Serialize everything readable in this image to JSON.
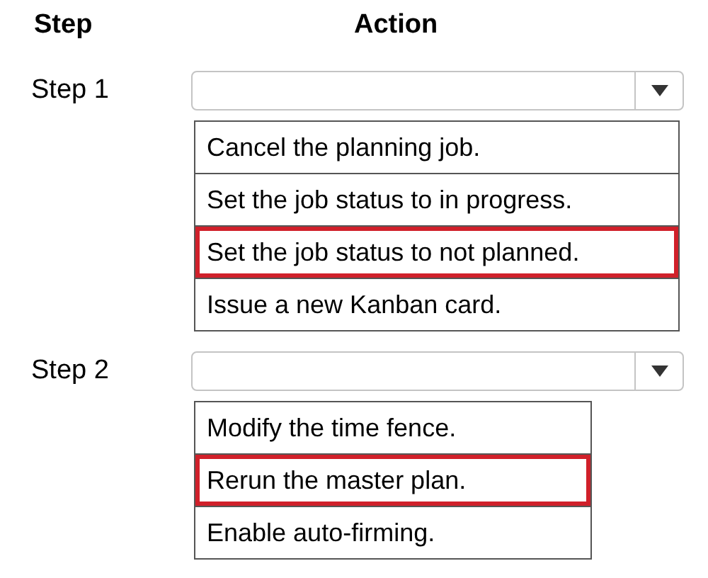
{
  "header": {
    "step": "Step",
    "action": "Action"
  },
  "steps": [
    {
      "label": "Step 1",
      "options": [
        {
          "text": "Cancel the planning job.",
          "selected": false
        },
        {
          "text": "Set the job status to in progress.",
          "selected": false
        },
        {
          "text": "Set the job status to not planned.",
          "selected": true
        },
        {
          "text": "Issue a new Kanban card.",
          "selected": false
        }
      ]
    },
    {
      "label": "Step 2",
      "options": [
        {
          "text": "Modify the time fence.",
          "selected": false
        },
        {
          "text": "Rerun the master plan.",
          "selected": true
        },
        {
          "text": "Enable auto-firming.",
          "selected": false
        }
      ]
    }
  ]
}
